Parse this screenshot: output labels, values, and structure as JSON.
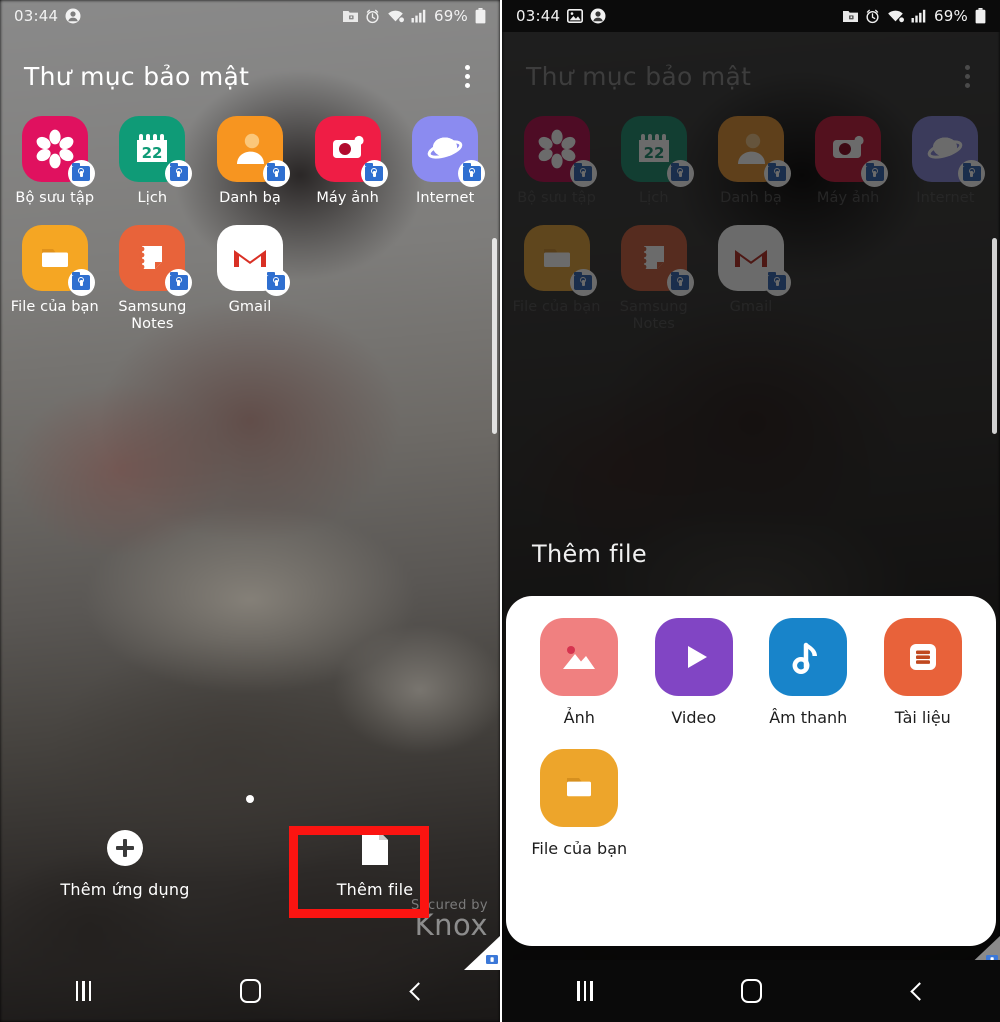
{
  "meta": {
    "left_panel_name": "secure-folder-home",
    "right_panel_name": "secure-folder-add-file-sheet"
  },
  "statusbar": {
    "time": "03:44",
    "battery_percent": "69%",
    "icons_left": [
      "image-icon",
      "account-icon"
    ],
    "icons_right": [
      "secure-folder-icon",
      "alarm-icon",
      "wifi-icon",
      "signal-icon",
      "battery-icon"
    ]
  },
  "header": {
    "title": "Thư mục bảo mật",
    "menu_icon": "kebab-menu-icon"
  },
  "apps": [
    {
      "label": "Bộ sưu tập",
      "icon": "gallery-icon",
      "bg": "#e0115f"
    },
    {
      "label": "Lịch",
      "icon": "calendar-icon",
      "bg": "#0f9b77",
      "day": "22"
    },
    {
      "label": "Danh bạ",
      "icon": "contacts-icon",
      "bg": "#f79520"
    },
    {
      "label": "Máy ảnh",
      "icon": "camera-icon",
      "bg": "#ef1d45"
    },
    {
      "label": "Internet",
      "icon": "internet-icon",
      "bg": "#8b8bf0"
    },
    {
      "label": "File của bạn",
      "icon": "my-files-icon",
      "bg": "#f5a623"
    },
    {
      "label": "Samsung Notes",
      "icon": "notes-icon",
      "bg": "#e8633a"
    },
    {
      "label": "Gmail",
      "icon": "gmail-icon",
      "bg": "#ffffff"
    }
  ],
  "bottom_actions": [
    {
      "label": "Thêm ứng dụng",
      "icon": "plus-circle-icon"
    },
    {
      "label": "Thêm file",
      "icon": "document-page-icon",
      "highlighted": true
    }
  ],
  "page_indicator": {
    "dots": 1,
    "active": 0
  },
  "watermark": {
    "line1": "Secured by",
    "line2": "Knox"
  },
  "sheet": {
    "title": "Thêm file",
    "items": [
      {
        "label": "Ảnh",
        "icon": "photo-icon",
        "bg": "#f08080"
      },
      {
        "label": "Video",
        "icon": "video-icon",
        "bg": "#8145c4"
      },
      {
        "label": "Âm thanh",
        "icon": "audio-icon",
        "bg": "#1884ca"
      },
      {
        "label": "Tài liệu",
        "icon": "document-icon",
        "bg": "#e8623a"
      },
      {
        "label": "File của bạn",
        "icon": "my-files-icon",
        "bg": "#eda52b"
      }
    ]
  },
  "navbar": {
    "recents_label": "recents-button",
    "home_label": "home-button",
    "back_label": "back-button"
  },
  "colors": {
    "annotation_red": "#fb1411",
    "sheet_background": "#ffffff",
    "navbar_background": "#0a0a0a"
  }
}
